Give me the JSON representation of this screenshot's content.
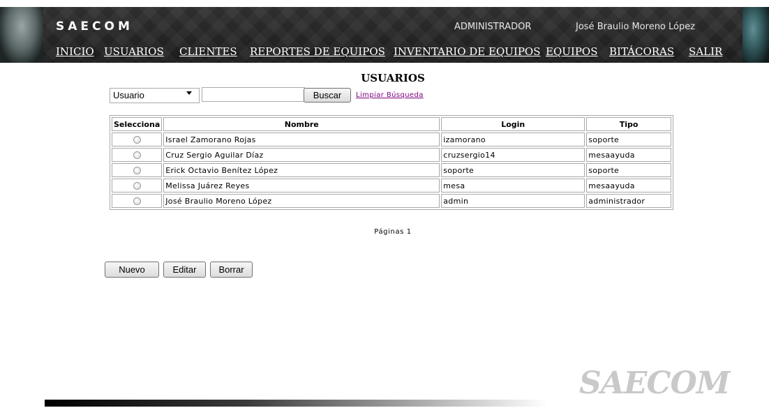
{
  "header": {
    "brand": "SAECOM",
    "role": "ADMINISTRADOR",
    "user": "José Braulio Moreno López",
    "nav": [
      "INICIO",
      "USUARIOS",
      "CLIENTES",
      "REPORTES DE EQUIPOS",
      "INVENTARIO DE EQUIPOS",
      "EQUIPOS",
      "BITÁCORAS",
      "SALIR"
    ]
  },
  "page": {
    "title": "USUARIOS"
  },
  "search": {
    "field_value": "Usuario",
    "input_value": "",
    "button": "Buscar",
    "clear_link": "Limpiar Búsqueda"
  },
  "table": {
    "headers": [
      "Selecciona",
      "Nombre",
      "Login",
      "Tipo"
    ],
    "rows": [
      {
        "nombre": "Israel Zamorano Rojas",
        "login": "izamorano",
        "tipo": "soporte"
      },
      {
        "nombre": "Cruz Sergio Aguilar Díaz",
        "login": "cruzsergio14",
        "tipo": "mesaayuda"
      },
      {
        "nombre": "Erick Octavio Benítez López",
        "login": "soporte",
        "tipo": "soporte"
      },
      {
        "nombre": "Melissa Juárez Reyes",
        "login": "mesa",
        "tipo": "mesaayuda"
      },
      {
        "nombre": "José Braulio Moreno López",
        "login": "admin",
        "tipo": "administrador"
      }
    ]
  },
  "pagination": {
    "text": "Páginas 1"
  },
  "actions": {
    "new": "Nuevo",
    "edit": "Editar",
    "delete": "Borrar"
  },
  "footer": {
    "logo": "SAECOM"
  }
}
